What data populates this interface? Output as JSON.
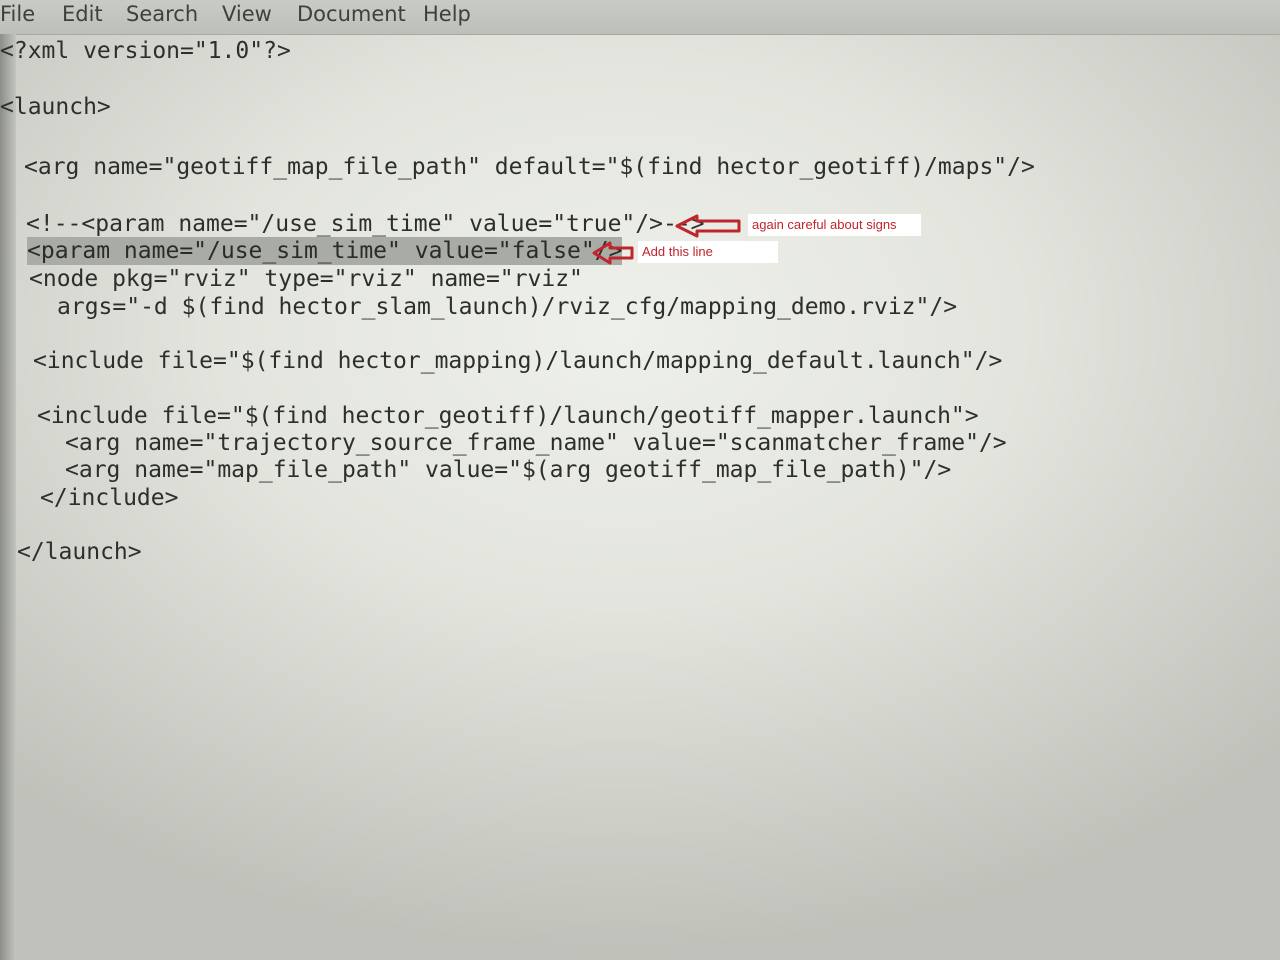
{
  "menu": {
    "items": [
      "File",
      "Edit",
      "Search",
      "View",
      "Document",
      "Help"
    ]
  },
  "editor": {
    "lines": [
      "<?xml version=\"1.0\"?>",
      "<launch>",
      "<arg name=\"geotiff_map_file_path\" default=\"$(find hector_geotiff)/maps\"/>",
      "<!--<param name=\"/use_sim_time\" value=\"true\"/>-->",
      "<param name=\"/use_sim_time\" value=\"false\"/>",
      "<node pkg=\"rviz\" type=\"rviz\" name=\"rviz\"",
      "args=\"-d $(find hector_slam_launch)/rviz_cfg/mapping_demo.rviz\"/>",
      "<include file=\"$(find hector_mapping)/launch/mapping_default.launch\"/>",
      "<include file=\"$(find hector_geotiff)/launch/geotiff_mapper.launch\">",
      "<arg name=\"trajectory_source_frame_name\" value=\"scanmatcher_frame\"/>",
      "<arg name=\"map_file_path\" value=\"$(arg geotiff_map_file_path)\"/>",
      "</include>",
      "</launch>"
    ]
  },
  "annotations": {
    "note_1": "again careful about signs",
    "note_2": "Add this line",
    "color": "#c0252c"
  },
  "colors": {
    "text": "#2d2f2c",
    "selection": "#a9aba5",
    "background": "#e2e4dd"
  }
}
